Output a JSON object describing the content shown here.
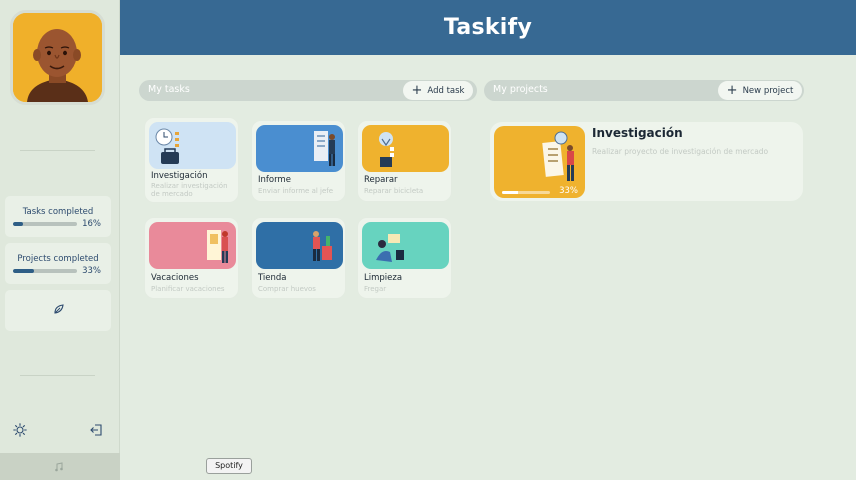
{
  "app": {
    "title": "Taskify"
  },
  "sidebar": {
    "stats": [
      {
        "label": "Tasks completed",
        "percent_text": "16%",
        "fraction": 0.16
      },
      {
        "label": "Projects completed",
        "percent_text": "33%",
        "fraction": 0.33
      }
    ],
    "icons": {
      "theme": "sun-icon",
      "logout": "logout-icon",
      "extra": "leaf-icon"
    }
  },
  "tasks_section": {
    "label": "My tasks",
    "add_label": "Add task",
    "items": [
      {
        "title": "Investigación",
        "desc": "Realizar investigación de mercado",
        "color": "#cfe3f4"
      },
      {
        "title": "Informe",
        "desc": "Enviar informe al jefe",
        "color": "#4a8ed0"
      },
      {
        "title": "Reparar",
        "desc": "Reparar bicicleta",
        "color": "#efb22e"
      },
      {
        "title": "Vacaciones",
        "desc": "Planificar vacaciones",
        "color": "#e98a9a"
      },
      {
        "title": "Tienda",
        "desc": "Comprar huevos",
        "color": "#2f6fa6"
      },
      {
        "title": "Limpieza",
        "desc": "Fregar",
        "color": "#67d3bf"
      }
    ]
  },
  "projects_section": {
    "label": "My projects",
    "add_label": "New project",
    "items": [
      {
        "title": "Investigación",
        "desc": "Realizar proyecto de investigación de mercado",
        "percent_text": "33%",
        "fraction": 0.33,
        "color": "#efb22e"
      }
    ]
  },
  "tooltip": {
    "text": "Spotify"
  }
}
